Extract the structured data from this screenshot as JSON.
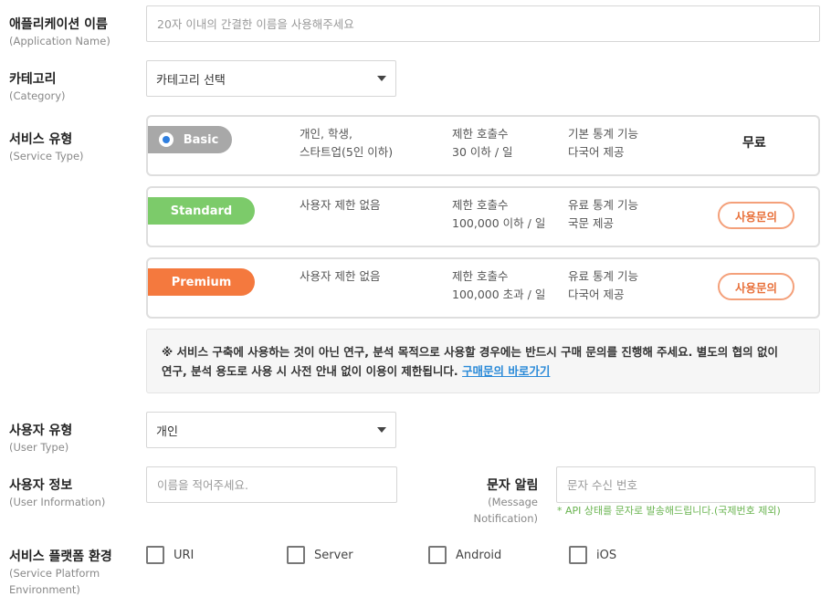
{
  "app_name": {
    "label": "애플리케이션 이름",
    "label_en": "(Application Name)",
    "placeholder": "20자 이내의 간결한 이름을 사용해주세요"
  },
  "category": {
    "label": "카테고리",
    "label_en": "(Category)",
    "selected": "카테고리 선택"
  },
  "service_type": {
    "label": "서비스 유형",
    "label_en": "(Service Type)",
    "plans": [
      {
        "name": "Basic",
        "color": "#a8a8a8",
        "selected": true,
        "target_line1": "개인, 학생,",
        "target_line2": "스타트업(5인 이하)",
        "calls_line1": "제한 호출수",
        "calls_line2": "30 이하 / 일",
        "features_line1": "기본 통계 기능",
        "features_line2": "다국어 제공",
        "price": "무료"
      },
      {
        "name": "Standard",
        "color": "#7ccb6a",
        "selected": false,
        "target_line1": "사용자 제한 없음",
        "calls_line1": "제한 호출수",
        "calls_line2": "100,000 이하 / 일",
        "features_line1": "유료 통계 기능",
        "features_line2": "국문 제공",
        "action": "사용문의"
      },
      {
        "name": "Premium",
        "color": "#f4793e",
        "selected": false,
        "target_line1": "사용자 제한 없음",
        "calls_line1": "제한 호출수",
        "calls_line2": "100,000 초과 / 일",
        "features_line1": "유료 통계 기능",
        "features_line2": "다국어 제공",
        "action": "사용문의"
      }
    ],
    "notice_line1": "※ 서비스 구축에 사용하는 것이 아닌 연구, 분석 목적으로 사용할 경우에는 반드시 구매 문의를 진행해 주세요. 별도의 협의 없이",
    "notice_line2": "연구, 분석 용도로 사용 시 사전 안내 없이 이용이 제한됩니다.",
    "notice_link": "구매문의 바로가기"
  },
  "user_type": {
    "label": "사용자 유형",
    "label_en": "(User Type)",
    "selected": "개인"
  },
  "user_info": {
    "label": "사용자 정보",
    "label_en": "(User Information)",
    "placeholder": "이름을 적어주세요."
  },
  "sms": {
    "label": "문자 알림",
    "label_en_line1": "(Message",
    "label_en_line2": "Notification)",
    "placeholder": "문자 수신 번호",
    "hint": "* API 상태를 문자로 발송해드립니다.(국제번호 제외)"
  },
  "platform": {
    "label": "서비스 플랫폼 환경",
    "label_en_line1": "(Service Platform",
    "label_en_line2": "Environment)",
    "options": [
      "URI",
      "Server",
      "Android",
      "iOS"
    ]
  }
}
